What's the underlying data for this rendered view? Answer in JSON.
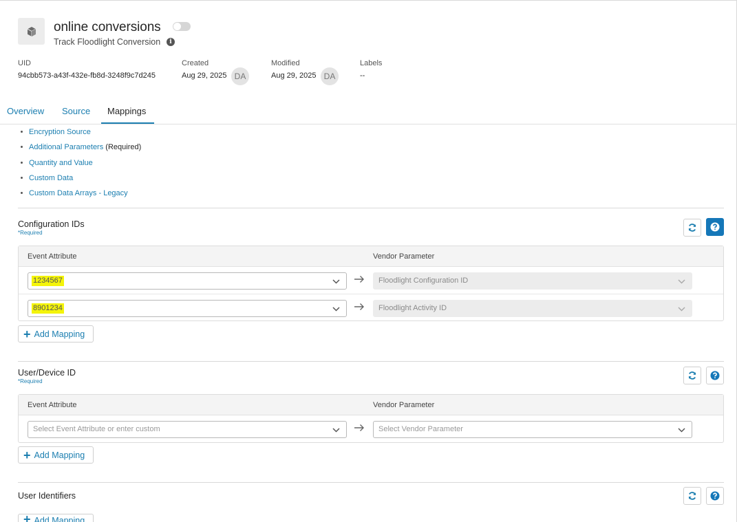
{
  "header": {
    "title": "online conversions",
    "subtitle": "Track Floodlight Conversion",
    "info_glyph": "i",
    "uid_label": "UID",
    "uid_value": "94cbb573-a43f-432e-fb8d-3248f9c7d245",
    "created_label": "Created",
    "created_value": "Aug 29, 2025",
    "created_by": "DA",
    "modified_label": "Modified",
    "modified_value": "Aug 29, 2025",
    "modified_by": "DA",
    "labels_label": "Labels",
    "labels_value": "--",
    "icon": "box-icon",
    "toggle_on": false
  },
  "tabs": [
    {
      "label": "Overview",
      "active": false
    },
    {
      "label": "Source",
      "active": false
    },
    {
      "label": "Mappings",
      "active": true
    }
  ],
  "links": [
    {
      "label": "Encryption Source",
      "suffix": ""
    },
    {
      "label": "Additional Parameters",
      "suffix": " (Required)"
    },
    {
      "label": "Quantity and Value",
      "suffix": ""
    },
    {
      "label": "Custom Data",
      "suffix": ""
    },
    {
      "label": "Custom Data Arrays - Legacy",
      "suffix": ""
    }
  ],
  "sections": {
    "config": {
      "title": "Configuration IDs",
      "required": "*Required",
      "col_event": "Event Attribute",
      "col_vendor": "Vendor Parameter",
      "rows": [
        {
          "event_value": "1234567",
          "vendor_value": "Floodlight Configuration ID"
        },
        {
          "event_value": "8901234",
          "vendor_value": "Floodlight Activity ID"
        }
      ],
      "add_label": "Add Mapping"
    },
    "user_device": {
      "title": "User/Device ID",
      "required": "*Required",
      "col_event": "Event Attribute",
      "col_vendor": "Vendor Parameter",
      "event_placeholder": "Select Event Attribute or enter custom",
      "vendor_placeholder": "Select Vendor Parameter",
      "add_label": "Add Mapping"
    },
    "user_identifiers": {
      "title": "User Identifiers",
      "add_label": "Add Mapping"
    }
  },
  "colors": {
    "accent": "#1b7eb0",
    "primary_button": "#1577b8",
    "highlight": "#f4f40a"
  }
}
